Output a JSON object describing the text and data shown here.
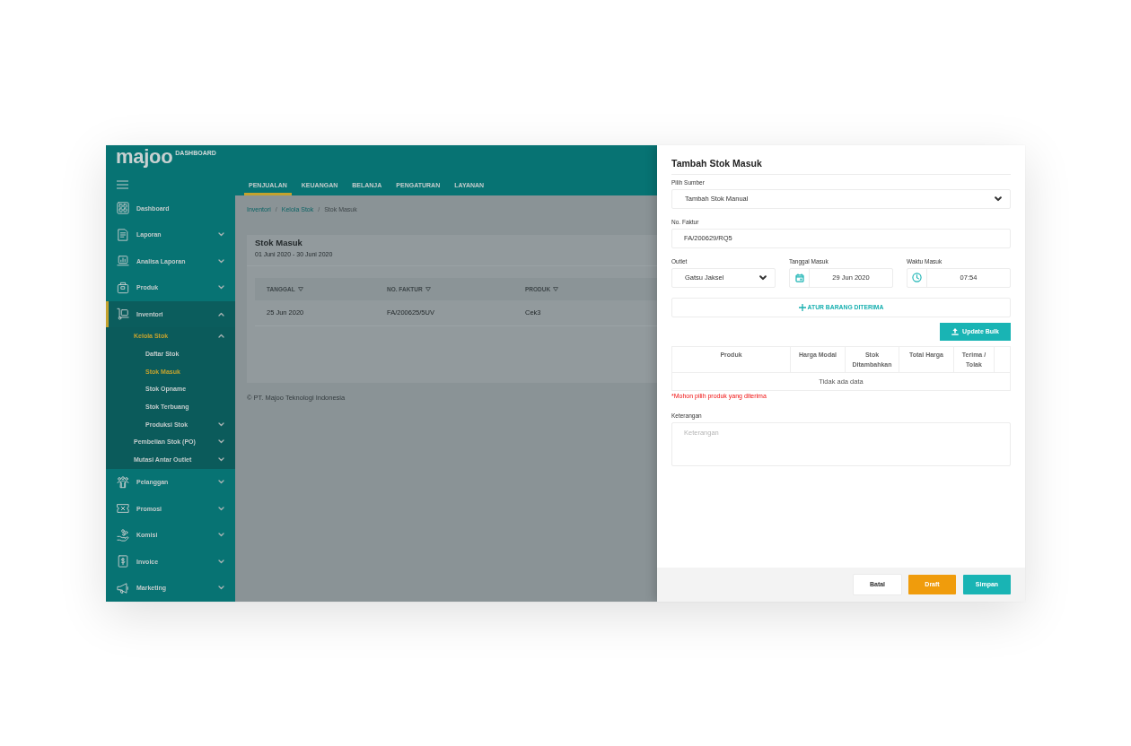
{
  "header": {
    "logo": "majoo",
    "logo_tag": "DASHBOARD"
  },
  "top_nav": [
    {
      "label": "PENJUALAN",
      "selected": true
    },
    {
      "label": "KEUANGAN",
      "selected": false
    },
    {
      "label": "BELANJA",
      "selected": false
    },
    {
      "label": "PENGATURAN",
      "selected": false
    },
    {
      "label": "LAYANAN",
      "selected": false
    }
  ],
  "sidebar": {
    "items": [
      {
        "label": "Dashboard",
        "kind": "link",
        "selected": false
      },
      {
        "label": "Laporan",
        "kind": "group",
        "selected": false,
        "expanded": false
      },
      {
        "label": "Analisa Laporan",
        "kind": "group",
        "selected": false,
        "expanded": false
      },
      {
        "label": "Produk",
        "kind": "group",
        "selected": false,
        "expanded": false
      },
      {
        "label": "Inventori",
        "kind": "group",
        "selected": true,
        "expanded": true,
        "children": [
          {
            "label": "Kelola Stok",
            "kind": "group",
            "selected": true,
            "expanded": true,
            "children": [
              {
                "label": "Daftar Stok",
                "kind": "link",
                "selected": false
              },
              {
                "label": "Stok Masuk",
                "kind": "link",
                "selected": true
              },
              {
                "label": "Stok Opname",
                "kind": "link",
                "selected": false
              },
              {
                "label": "Stok Terbuang",
                "kind": "link",
                "selected": false
              },
              {
                "label": "Produksi Stok",
                "kind": "group",
                "selected": false,
                "expanded": false
              }
            ]
          },
          {
            "label": "Pembelian Stok (PO)",
            "kind": "group",
            "selected": false,
            "expanded": false
          },
          {
            "label": "Mutasi Antar Outlet",
            "kind": "group",
            "selected": false,
            "expanded": false
          }
        ]
      },
      {
        "label": "Pelanggan",
        "kind": "group",
        "selected": false,
        "expanded": false
      },
      {
        "label": "Promosi",
        "kind": "group",
        "selected": false,
        "expanded": false
      },
      {
        "label": "Komisi",
        "kind": "group",
        "selected": false,
        "expanded": false
      },
      {
        "label": "Invoice",
        "kind": "group",
        "selected": false,
        "expanded": false
      },
      {
        "label": "Marketing",
        "kind": "group",
        "selected": false,
        "expanded": false
      }
    ]
  },
  "breadcrumb": [
    {
      "label": "Inventori",
      "kind": "link"
    },
    {
      "label": "/",
      "kind": "separator"
    },
    {
      "label": "Kelola Stok",
      "kind": "link"
    },
    {
      "label": "/",
      "kind": "separator"
    },
    {
      "label": "Stok Masuk",
      "kind": "current"
    }
  ],
  "page": {
    "title": "Stok Masuk",
    "date_range": "01 Juni 2020 - 30 Juni 2020",
    "table": {
      "columns": [
        {
          "label": "TANGGAL",
          "sortable": true
        },
        {
          "label": "NO. FAKTUR",
          "sortable": true
        },
        {
          "label": "PRODUK",
          "sortable": true
        }
      ],
      "rows": [
        [
          "25 Jun 2020",
          "FA/200625/5UV",
          "Cek3"
        ]
      ]
    }
  },
  "footer": "© PT. Majoo Teknologi Indonesia",
  "drawer": {
    "title": "Tambah Stok Masuk",
    "source": {
      "label": "Pilih Sumber",
      "value": "Tambah Stok Manual"
    },
    "invoice_no": {
      "label": "No. Faktur",
      "value": "FA/200629/RQ5"
    },
    "outlet": {
      "label": "Outlet",
      "value": "Gatsu Jaksel"
    },
    "date_in": {
      "label": "Tanggal Masuk",
      "value": "29 Jun 2020"
    },
    "time_in": {
      "label": "Waktu Masuk",
      "value": "07:54"
    },
    "add_items_button": "ATUR BARANG DITERIMA",
    "bulk_button": "Update Bulk",
    "items_table": {
      "columns": [
        "Produk",
        "Harga Modal",
        "Stok Ditambahkan",
        "Total Harga",
        "Terima / Tolak"
      ],
      "empty_text": "Tidak ada data"
    },
    "error": "*Mohon pilih produk yang diterima",
    "notes": {
      "label": "Keterangan",
      "placeholder": "Keterangan"
    },
    "buttons": [
      {
        "label": "Batal",
        "kind": "secondary"
      },
      {
        "label": "Draft",
        "kind": "draft"
      },
      {
        "label": "Simpan",
        "kind": "primary"
      }
    ]
  }
}
